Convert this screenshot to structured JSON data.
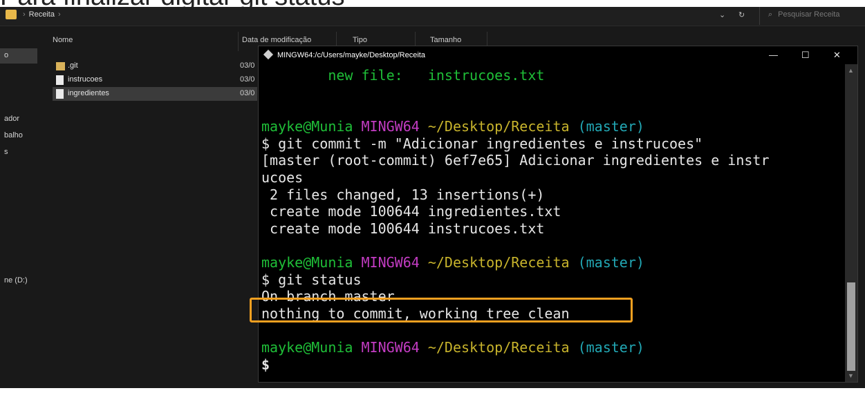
{
  "slide": {
    "title": "Para finalizar digitar git status"
  },
  "explorer": {
    "breadcrumb": {
      "folder": "Receita",
      "sep": "›"
    },
    "controls": {
      "dropdown": "⌄",
      "refresh": "↻"
    },
    "search": {
      "placeholder": "Pesquisar Receita",
      "icon": "search-icon"
    },
    "sidebar": [
      "o",
      "ador",
      "balho",
      "s",
      "ne (D:)"
    ],
    "columns": {
      "name": "Nome",
      "date": "Data de modificação",
      "type": "Tipo",
      "size": "Tamanho"
    },
    "files": [
      {
        "name": ".git",
        "date": "03/0",
        "icon": "folder-icon"
      },
      {
        "name": "instrucoes",
        "date": "03/0",
        "icon": "file-icon"
      },
      {
        "name": "ingredientes",
        "date": "03/0",
        "icon": "file-icon",
        "selected": true
      }
    ]
  },
  "terminal": {
    "title": "MINGW64:/c/Users/mayke/Desktop/Receita",
    "buttons": {
      "minimize": "—",
      "maximize": "☐",
      "close": "✕"
    },
    "lines": {
      "l1_a": "        new file:   ",
      "l1_b": "instrucoes.txt",
      "p1_user": "mayke@Munia",
      "p1_env": "MINGW64",
      "p1_path": "~/Desktop/Receita",
      "p1_branch": "(master)",
      "cmd1": "$ git commit -m \"Adicionar ingredientes e instrucoes\"",
      "out1": "[master (root-commit) 6ef7e65] Adicionar ingredientes e instr",
      "out2": "ucoes",
      "out3": " 2 files changed, 13 insertions(+)",
      "out4": " create mode 100644 ingredientes.txt",
      "out5": " create mode 100644 instrucoes.txt",
      "p2_user": "mayke@Munia",
      "p2_env": "MINGW64",
      "p2_path": "~/Desktop/Receita",
      "p2_branch": "(master)",
      "cmd2": "$ git status",
      "out6": "On branch master",
      "out7": "nothing to commit, working tree clean",
      "p3_user": "mayke@Munia",
      "p3_env": "MINGW64",
      "p3_path": "~/Desktop/Receita",
      "p3_branch": "(master)",
      "cmd3": "$"
    },
    "colors": {
      "user": "#1fbf38",
      "env": "#c33cc3",
      "path": "#c8b42c",
      "branch": "#22a8b5",
      "highlight": "#f4a020"
    }
  }
}
